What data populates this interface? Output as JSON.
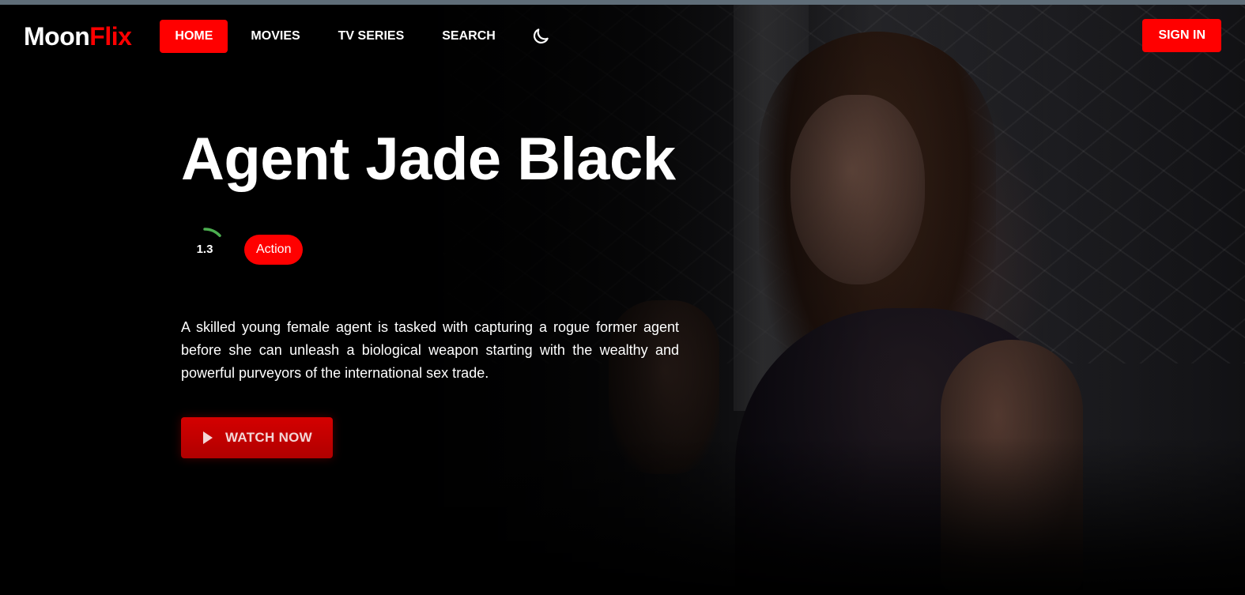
{
  "brand": {
    "part1": "Moon",
    "part2": "Flix"
  },
  "nav": {
    "items": [
      {
        "label": "HOME",
        "active": true
      },
      {
        "label": "MOVIES",
        "active": false
      },
      {
        "label": "TV SERIES",
        "active": false
      },
      {
        "label": "SEARCH",
        "active": false
      }
    ],
    "theme_icon": "moon-icon",
    "signin_label": "SIGN IN"
  },
  "hero": {
    "title": "Agent Jade Black",
    "rating": "1.3",
    "rating_fraction": 0.13,
    "genre": "Action",
    "overview": "A skilled young female agent is tasked with capturing a rogue former agent before she can unleash a biological weapon starting with the wealthy and powerful purveyors of the international sex trade.",
    "watch_label": "WATCH NOW",
    "watch_icon": "play-icon"
  },
  "colors": {
    "accent": "#ff0000",
    "rating_arc": "#4caf50",
    "background": "#000000"
  }
}
